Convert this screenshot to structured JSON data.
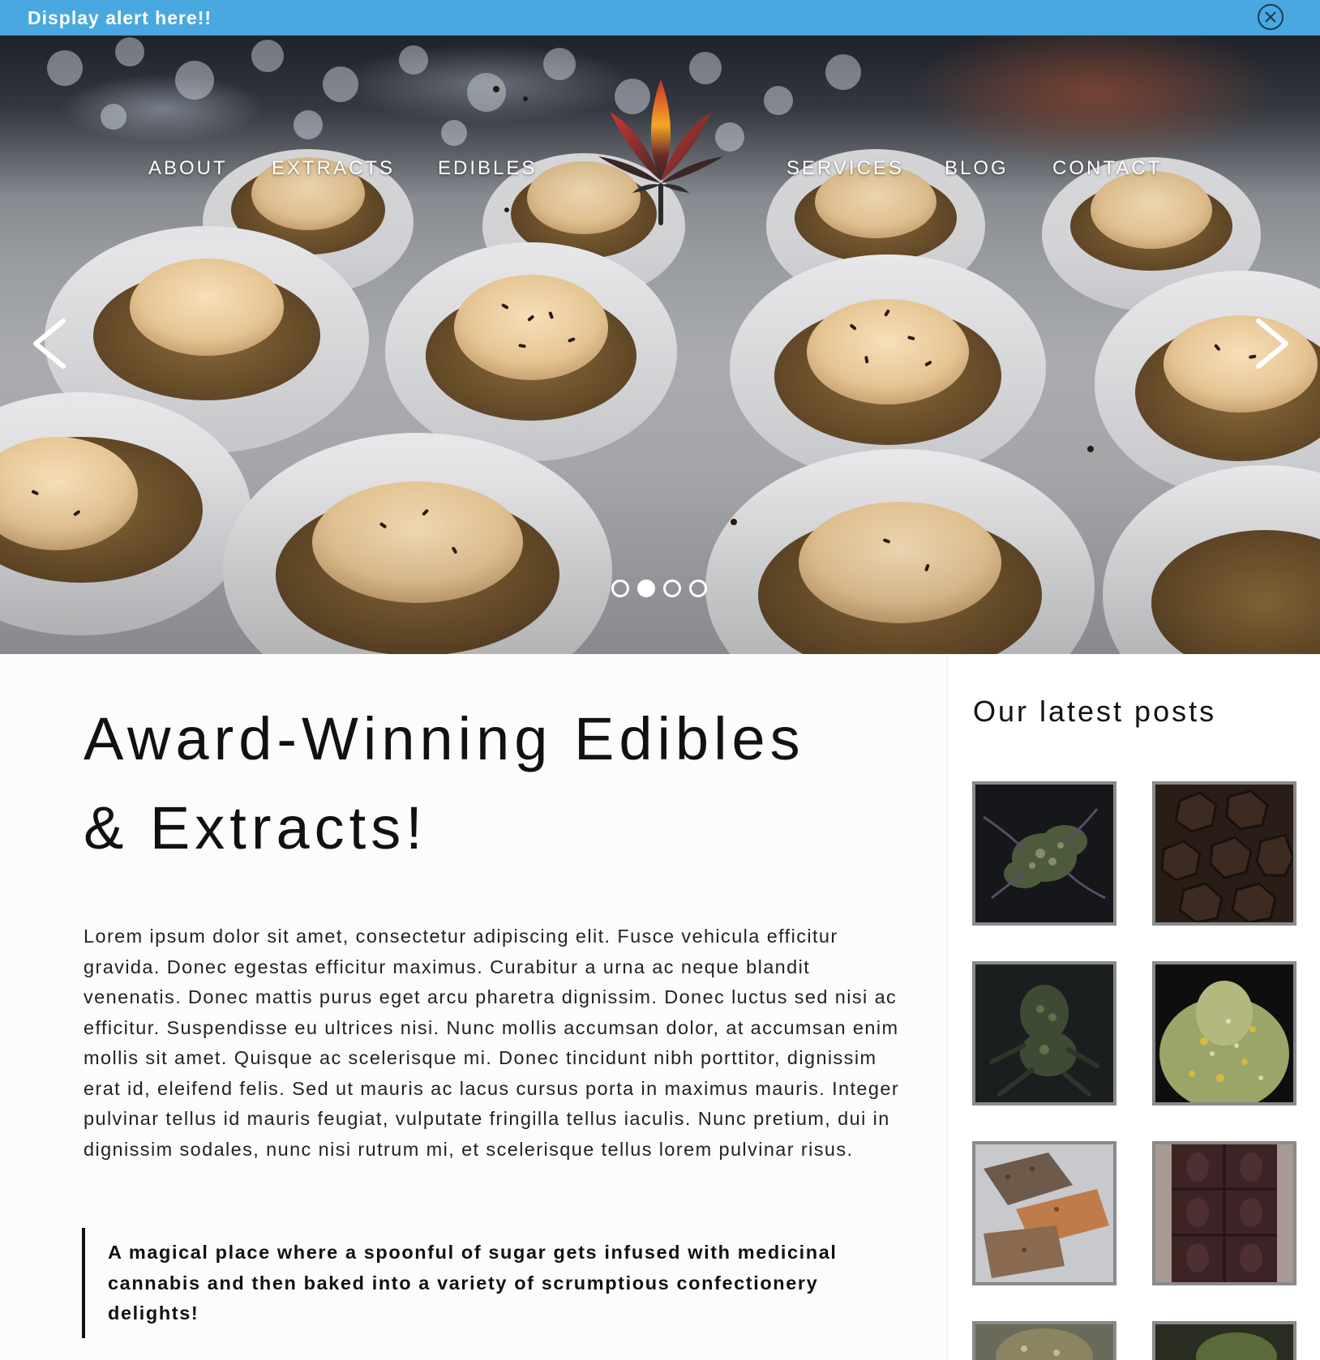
{
  "alert": {
    "text": "Display alert here!!",
    "close_icon": "close-circle-icon"
  },
  "nav": {
    "items": [
      {
        "label": "ABOUT"
      },
      {
        "label": "EXTRACTS"
      },
      {
        "label": "EDIBLES"
      },
      {
        "label": "SERVICES"
      },
      {
        "label": "BLOG"
      },
      {
        "label": "CONTACT"
      }
    ],
    "logo_icon": "cannabis-leaf-logo-icon"
  },
  "carousel": {
    "prev_icon": "chevron-left-icon",
    "next_icon": "chevron-right-icon",
    "slide_count": 4,
    "active_index": 1
  },
  "main": {
    "headline_line1": "Award-Winning Edibles",
    "headline_line2": "& Extracts!",
    "body": "Lorem ipsum dolor sit amet, consectetur adipiscing elit. Fusce vehicula efficitur gravida. Donec egestas efficitur maximus. Curabitur a urna ac neque blandit venenatis. Donec mattis purus eget arcu pharetra dignissim. Donec luctus sed nisi ac efficitur. Suspendisse eu ultrices nisi. Nunc mollis accumsan dolor, at accumsan enim mollis sit amet. Quisque ac scelerisque mi. Donec tincidunt nibh porttitor, dignissim erat id, eleifend felis. Sed ut mauris ac lacus cursus porta in maximus mauris. Integer pulvinar tellus id mauris feugiat, vulputate fringilla tellus iaculis. Nunc pretium, dui in dignissim sodales, nunc nisi rutrum mi, et scelerisque tellus lorem pulvinar risus.",
    "quote": "A magical place where a spoonful of sugar gets infused with medicinal cannabis and then baked into a variety of scrumptious confectionery delights!"
  },
  "sidebar": {
    "title": "Our latest posts"
  },
  "colors": {
    "alert_bg": "#49a8e0",
    "thumb_border": "#8a8a8a",
    "logo_red": "#c9302c",
    "logo_orange": "#f5a623"
  }
}
